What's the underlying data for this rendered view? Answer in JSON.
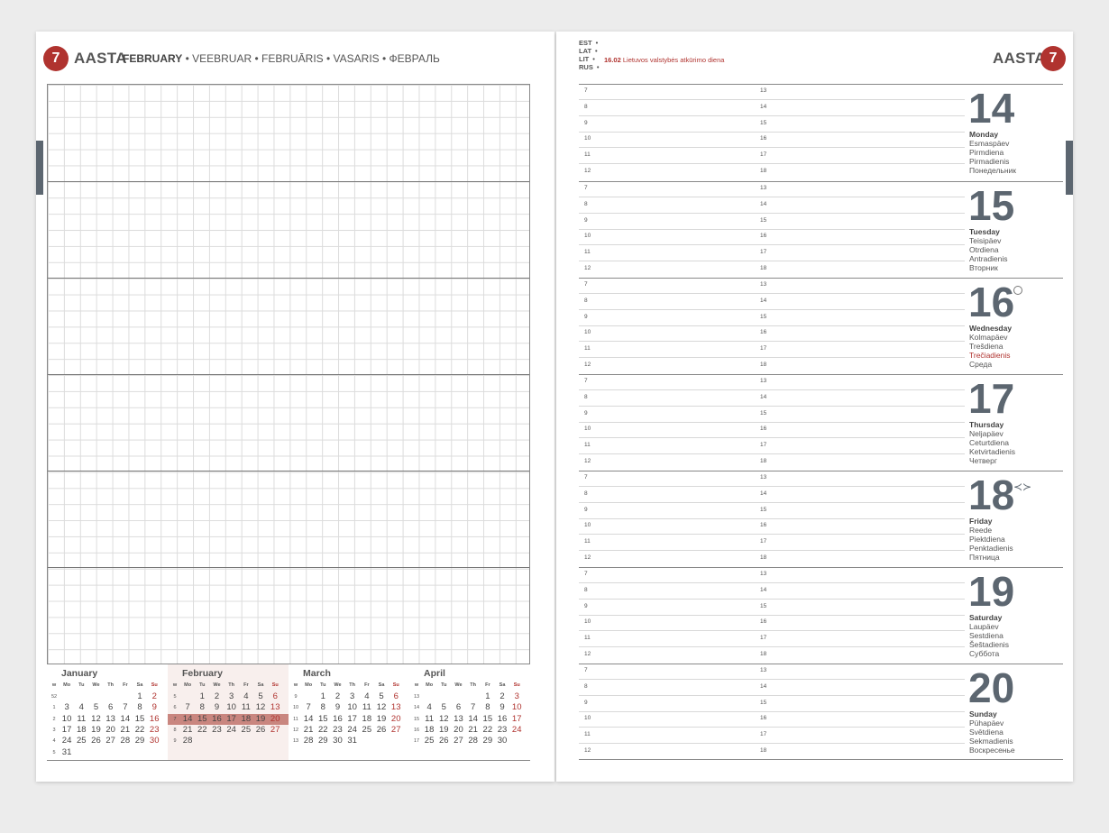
{
  "week_number": "7",
  "brand": "AASTA",
  "month_header": {
    "bold": "FEBRUARY",
    "rest": " • VEEBRUAR • FEBRUĀRIS • VASARIS • ФЕВРАЛЬ"
  },
  "languages": [
    "EST",
    "LAT",
    "LIT",
    "RUS"
  ],
  "holiday": {
    "date": "16.02",
    "text": "Lietuvos valstybės atkūrimo diena"
  },
  "weekday_abbr": [
    "w",
    "Mo",
    "Tu",
    "We",
    "Th",
    "Fr",
    "Sa",
    "Su"
  ],
  "mini_calendars": [
    {
      "name": "January",
      "weeks": [
        [
          "52",
          "",
          "",
          "",
          "",
          "",
          "1",
          "2"
        ],
        [
          "1",
          "3",
          "4",
          "5",
          "6",
          "7",
          "8",
          "9"
        ],
        [
          "2",
          "10",
          "11",
          "12",
          "13",
          "14",
          "15",
          "16"
        ],
        [
          "3",
          "17",
          "18",
          "19",
          "20",
          "21",
          "22",
          "23"
        ],
        [
          "4",
          "24",
          "25",
          "26",
          "27",
          "28",
          "29",
          "30"
        ],
        [
          "5",
          "31",
          "",
          "",
          "",
          "",
          "",
          ""
        ]
      ]
    },
    {
      "name": "February",
      "weeks": [
        [
          "5",
          "",
          "1",
          "2",
          "3",
          "4",
          "5",
          "6"
        ],
        [
          "6",
          "7",
          "8",
          "9",
          "10",
          "11",
          "12",
          "13"
        ],
        [
          "7",
          "14",
          "15",
          "16",
          "17",
          "18",
          "19",
          "20"
        ],
        [
          "8",
          "21",
          "22",
          "23",
          "24",
          "25",
          "26",
          "27"
        ],
        [
          "9",
          "28",
          "",
          "",
          "",
          "",
          "",
          ""
        ]
      ]
    },
    {
      "name": "March",
      "weeks": [
        [
          "9",
          "",
          "1",
          "2",
          "3",
          "4",
          "5",
          "6"
        ],
        [
          "10",
          "7",
          "8",
          "9",
          "10",
          "11",
          "12",
          "13"
        ],
        [
          "11",
          "14",
          "15",
          "16",
          "17",
          "18",
          "19",
          "20"
        ],
        [
          "12",
          "21",
          "22",
          "23",
          "24",
          "25",
          "26",
          "27"
        ],
        [
          "13",
          "28",
          "29",
          "30",
          "31",
          "",
          "",
          ""
        ]
      ]
    },
    {
      "name": "April",
      "weeks": [
        [
          "13",
          "",
          "",
          "",
          "",
          "1",
          "2",
          "3"
        ],
        [
          "14",
          "4",
          "5",
          "6",
          "7",
          "8",
          "9",
          "10"
        ],
        [
          "15",
          "11",
          "12",
          "13",
          "14",
          "15",
          "16",
          "17"
        ],
        [
          "16",
          "18",
          "19",
          "20",
          "21",
          "22",
          "23",
          "24"
        ],
        [
          "17",
          "25",
          "26",
          "27",
          "28",
          "29",
          "30",
          ""
        ]
      ]
    }
  ],
  "current_month_index": 1,
  "current_week_row": 2,
  "hours_left": [
    "7",
    "8",
    "9",
    "10",
    "11",
    "12"
  ],
  "hours_right": [
    "13",
    "14",
    "15",
    "16",
    "17",
    "18"
  ],
  "days": [
    {
      "num": "14",
      "names": [
        "Monday",
        "Esmaspäev",
        "Pirmdiena",
        "Pirmadienis",
        "Понедельник"
      ]
    },
    {
      "num": "15",
      "names": [
        "Tuesday",
        "Teisipäev",
        "Otrdiena",
        "Antradienis",
        "Вторник"
      ]
    },
    {
      "num": "16",
      "names": [
        "Wednesday",
        "Kolmapäev",
        "Trešdiena",
        "Trečiadienis",
        "Среда"
      ],
      "red_index": 3,
      "icon": "moon-icon"
    },
    {
      "num": "17",
      "names": [
        "Thursday",
        "Neljapäev",
        "Ceturtdiena",
        "Ketvirtadienis",
        "Четверг"
      ]
    },
    {
      "num": "18",
      "names": [
        "Friday",
        "Reede",
        "Piektdiena",
        "Penktadienis",
        "Пятница"
      ],
      "icon": "fish-icon"
    },
    {
      "num": "19",
      "names": [
        "Saturday",
        "Laupäev",
        "Sestdiena",
        "Šeštadienis",
        "Суббота"
      ]
    },
    {
      "num": "20",
      "names": [
        "Sunday",
        "Pühapäev",
        "Svētdiena",
        "Sekmadienis",
        "Воскресенье"
      ]
    }
  ],
  "colors": {
    "accent": "#b0332f",
    "highlight": "#c9867f",
    "slate": "#5c6670"
  }
}
